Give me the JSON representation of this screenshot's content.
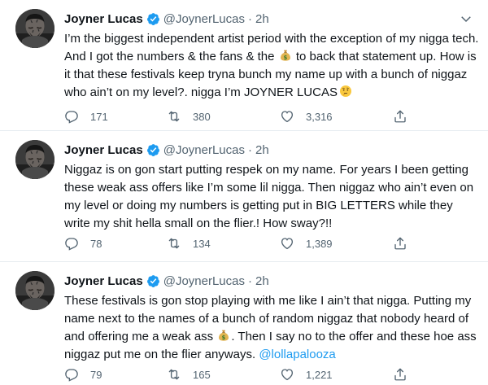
{
  "author": {
    "display_name": "Joyner Lucas",
    "handle": "@JoynerLucas",
    "separator": "·",
    "time": "2h"
  },
  "colors": {
    "text": "#0f1419",
    "secondary": "#536471",
    "link": "#1d9bf0",
    "verified": "#1d9bf0",
    "divider": "#e6ecf0"
  },
  "icons": [
    "verified-icon",
    "caret-down-icon",
    "reply-icon",
    "retweet-icon",
    "like-icon",
    "share-icon",
    "money-bag-emoji",
    "thinking-face-emoji"
  ],
  "tweets": [
    {
      "text_a": "I’m the biggest independent artist period with the exception of my nigga tech. And I got the numbers & the fans & the",
      "text_b": "to back that statement up. How is it that these festivals keep tryna bunch my name up with a bunch of niggaz who ain’t on my level?. nigga I’m JOYNER LUCAS",
      "replies": "171",
      "retweets": "380",
      "likes": "3,316"
    },
    {
      "text": "Niggaz is on gon start putting respek on my name. For years I been getting these weak ass offers like I’m some lil nigga. Then niggaz who ain’t even on my level or doing my numbers is getting put in BIG LETTERS while they write my shit hella small on the flier.! How sway?!!",
      "replies": "78",
      "retweets": "134",
      "likes": "1,389"
    },
    {
      "text_a": "These festivals is gon stop playing with me like I ain’t that nigga. Putting my name next to the names of a bunch of random niggaz that nobody heard of and offering me a weak ass",
      "text_b": ". Then I say no to the offer and these hoe ass niggaz put me on the flier anyways.",
      "mention": "@lollapalooza",
      "replies": "79",
      "retweets": "165",
      "likes": "1,221"
    }
  ]
}
